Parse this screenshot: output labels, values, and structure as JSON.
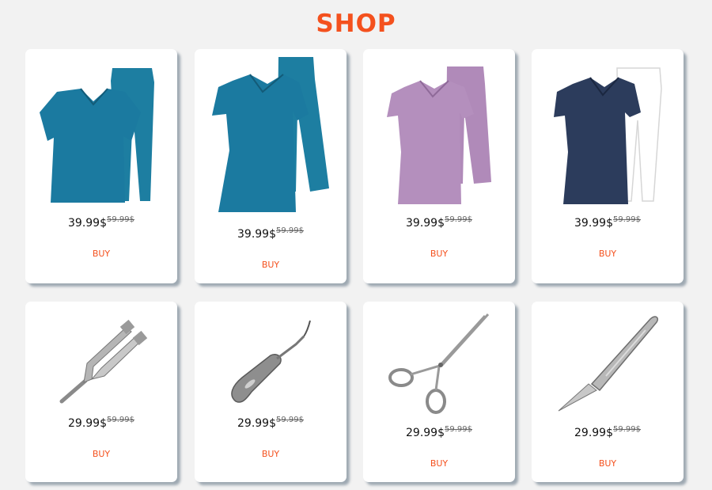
{
  "page": {
    "title": "SHOP"
  },
  "colors": {
    "accent": "#f4511e",
    "background": "#f2f2f2"
  },
  "products": [
    {
      "name": "Teal scrub set (v-neck top and pants)",
      "price": "39.99$",
      "old_price": "59.99$",
      "buy_label": "BUY"
    },
    {
      "name": "Teal wrap tunic and pants set",
      "price": "39.99$",
      "old_price": "59.99$",
      "buy_label": "BUY"
    },
    {
      "name": "Lilac wrap tunic and pants set",
      "price": "39.99$",
      "old_price": "59.99$",
      "buy_label": "BUY"
    },
    {
      "name": "Navy tunic with white pants",
      "price": "39.99$",
      "old_price": "59.99$",
      "buy_label": "BUY"
    },
    {
      "name": "Tuning fork",
      "price": "29.99$",
      "old_price": "59.99$",
      "buy_label": "BUY"
    },
    {
      "name": "Dental elevator",
      "price": "29.99$",
      "old_price": "59.99$",
      "buy_label": "BUY"
    },
    {
      "name": "Hemostatic forceps",
      "price": "29.99$",
      "old_price": "59.99$",
      "buy_label": "BUY"
    },
    {
      "name": "Surgical scalpel",
      "price": "29.99$",
      "old_price": "59.99$",
      "buy_label": "BUY"
    }
  ]
}
